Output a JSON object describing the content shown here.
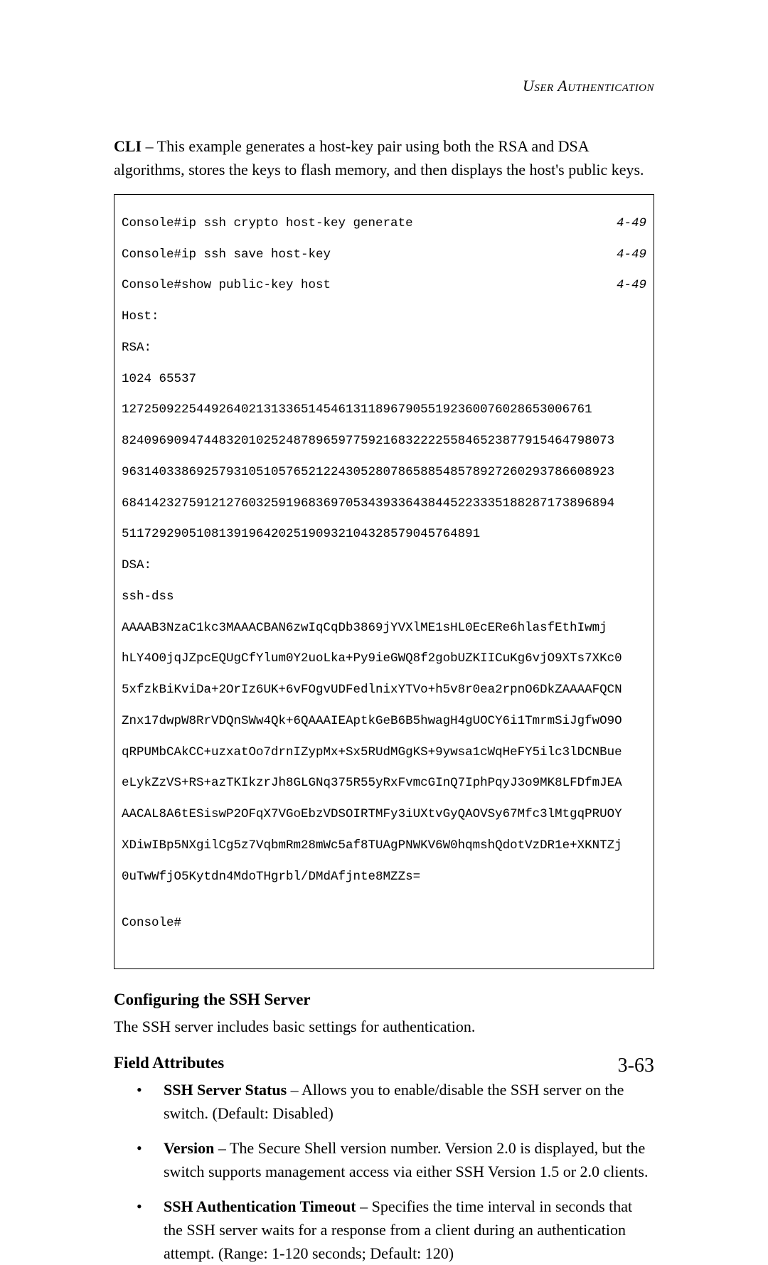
{
  "running_head": "User Authentication",
  "intro": {
    "cli_label": "CLI",
    "sep": " – ",
    "text": "This example generates a host-key pair using both the RSA and DSA algorithms, stores the keys to flash memory, and then displays the host's public keys."
  },
  "terminal": {
    "rows": [
      {
        "left": "Console#ip ssh crypto host-key generate",
        "right": "4-49"
      },
      {
        "left": "Console#ip ssh save host-key",
        "right": "4-49"
      },
      {
        "left": "Console#show public-key host",
        "right": "4-49"
      }
    ],
    "lines": [
      "Host:",
      "RSA:",
      "1024 65537",
      "127250922544926402131336514546131189679055192360076028653006761",
      "824096909474483201025248789659775921683222255846523877915464798073",
      "963140338692579310510576521224305280786588548578927260293786608923",
      "684142327591212760325919683697053439336438445223335188287173896894",
      "511729290510813919642025190932104328579045764891",
      "DSA:",
      "ssh-dss",
      "AAAAB3NzaC1kc3MAAACBAN6zwIqCqDb3869jYVXlME1sHL0EcERe6hlasfEthIwmj",
      "hLY4O0jqJZpcEQUgCfYlum0Y2uoLka+Py9ieGWQ8f2gobUZKIICuKg6vjO9XTs7XKc0",
      "5xfzkBiKviDa+2OrIz6UK+6vFOgvUDFedlnixYTVo+h5v8r0ea2rpnO6DkZAAAAFQCN",
      "Znx17dwpW8RrVDQnSWw4Qk+6QAAAIEAptkGeB6B5hwagH4gUOCY6i1TmrmSiJgfwO9O",
      "qRPUMbCAkCC+uzxatOo7drnIZypMx+Sx5RUdMGgKS+9ywsa1cWqHeFY5ilc3lDCNBue",
      "eLykZzVS+RS+azTKIkzrJh8GLGNq375R55yRxFvmcGInQ7IphPqyJ3o9MK8LFDfmJEA",
      "AACAL8A6tESiswP2OFqX7VGoEbzVDSOIRTMFy3iUXtvGyQAOVSy67Mfc3lMtgqPRUOY",
      "XDiwIBp5NXgilCg5z7VqbmRm28mWc5af8TUAgPNWKV6W0hqmshQdotVzDR1e+XKNTZj",
      "0uTwWfjO5Kytdn4MdoTHgrbl/DMdAfjnte8MZZs=",
      "",
      "Console#"
    ]
  },
  "section1": {
    "title": "Configuring the SSH Server",
    "text": "The SSH server includes basic settings for authentication."
  },
  "section2": {
    "title": "Field Attributes"
  },
  "fields": [
    {
      "term": "SSH Server Status",
      "sep": " – ",
      "text": "Allows you to enable/disable the SSH server on the switch. (Default: Disabled)"
    },
    {
      "term": "Version",
      "sep": " – ",
      "text": "The Secure Shell version number. Version 2.0 is displayed, but the switch supports management access via either SSH Version 1.5 or 2.0 clients."
    },
    {
      "term": "SSH Authentication Timeout",
      "sep": " – ",
      "text": "Specifies the time interval in seconds that the SSH server waits for a response from a client during an authentication attempt. (Range: 1-120 seconds; Default: 120)"
    }
  ],
  "page_number": "3-63"
}
